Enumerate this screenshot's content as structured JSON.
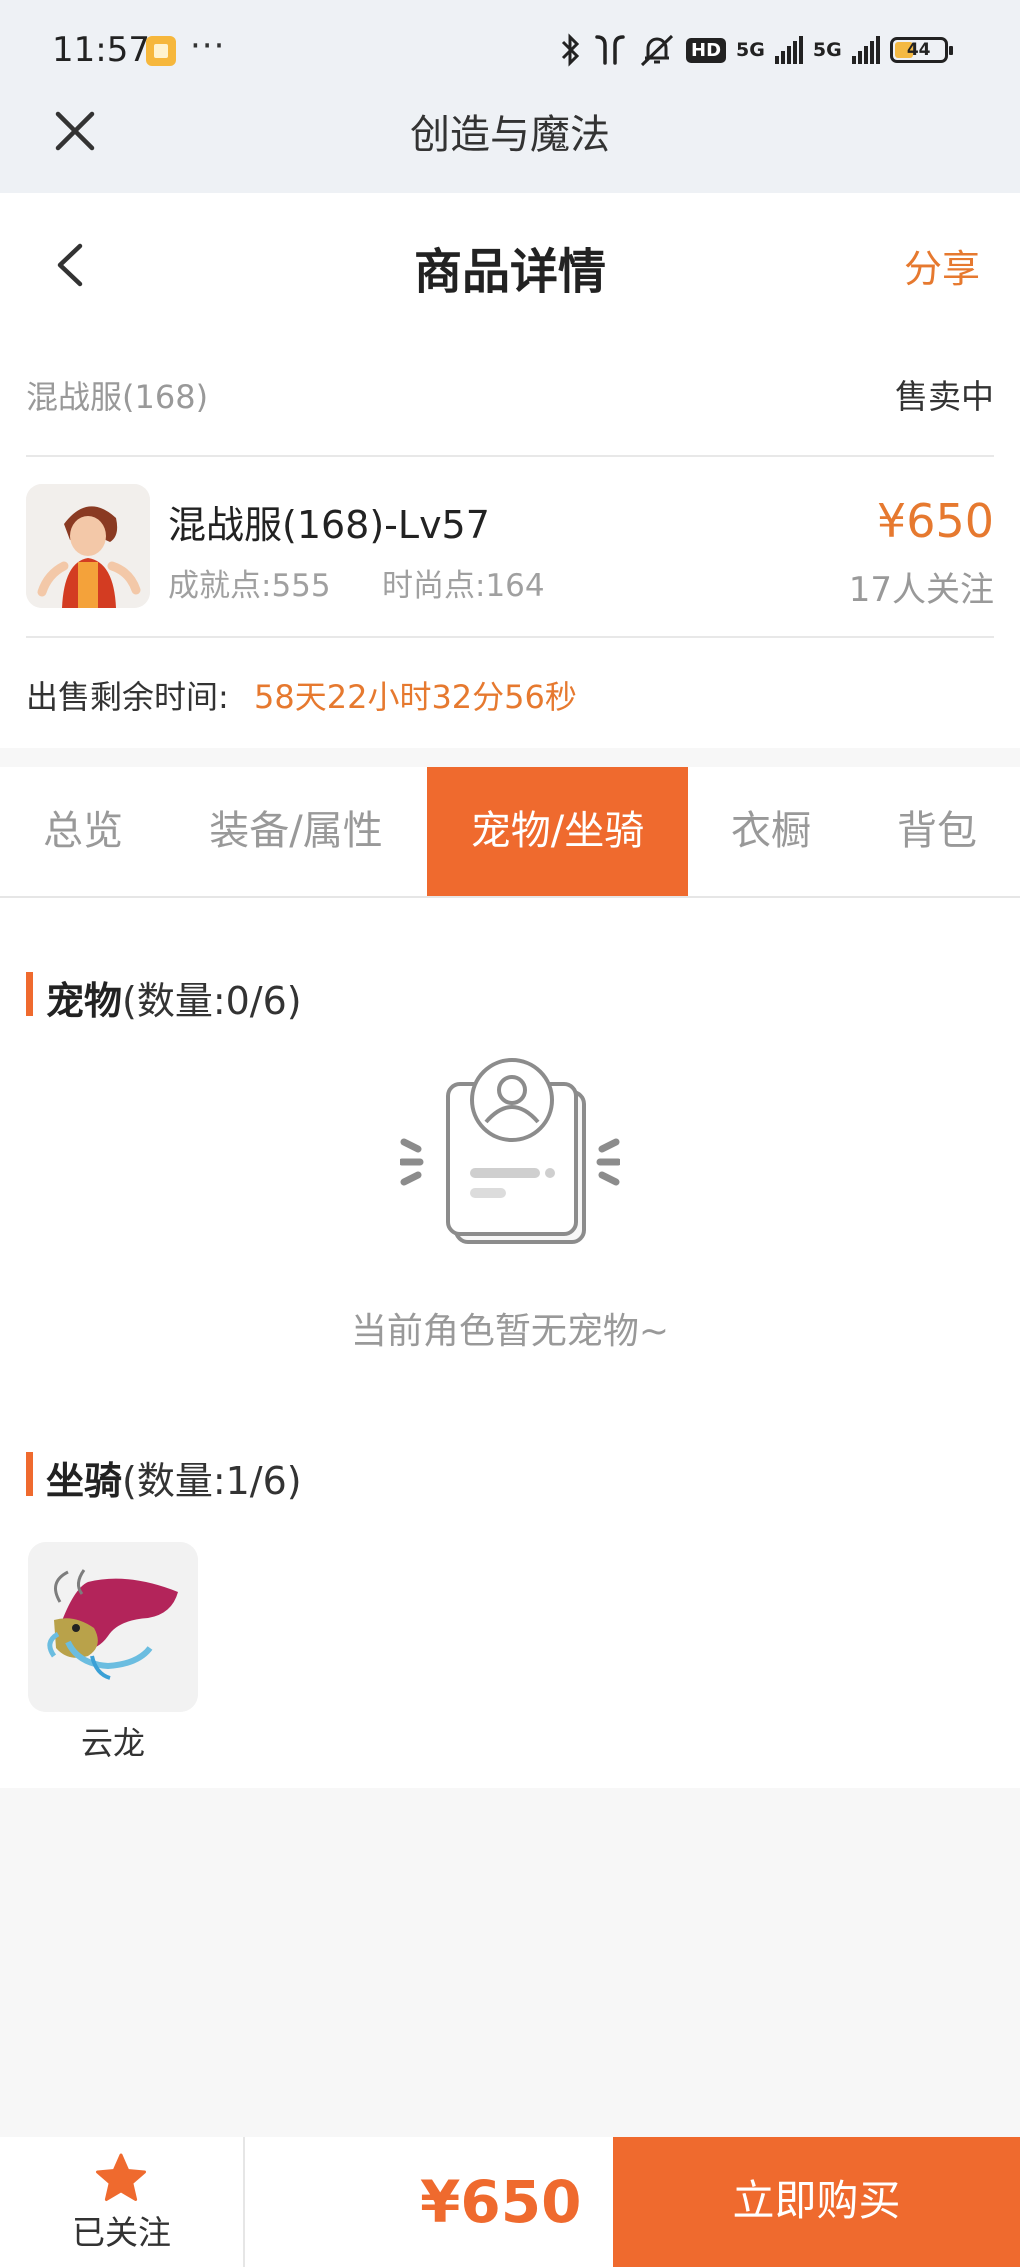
{
  "status_bar": {
    "time": "11:57",
    "dots": "···",
    "icons": [
      "bluetooth-icon",
      "earbuds-icon",
      "mute-icon",
      "hd-icon",
      "signal-5g-icon",
      "signal-5g-icon",
      "battery-icon"
    ],
    "hd_label": "HD",
    "net1": "5G",
    "net2": "5G",
    "battery_level": "44"
  },
  "miniapp": {
    "title": "创造与魔法"
  },
  "header": {
    "title": "商品详情",
    "share_label": "分享"
  },
  "listing": {
    "server": "混战服(168)",
    "status": "售卖中",
    "name": "混战服(168)-Lv57",
    "achievement": "成就点:555",
    "fashion": "时尚点:164",
    "price": "¥650",
    "followers": "17人关注",
    "time_label": "出售剩余时间:",
    "time_value": "58天22小时32分56秒"
  },
  "tabs": [
    {
      "label": "总览",
      "active": false
    },
    {
      "label": "装备/属性",
      "active": false
    },
    {
      "label": "宠物/坐骑",
      "active": true
    },
    {
      "label": "衣橱",
      "active": false
    },
    {
      "label": "背包",
      "active": false
    }
  ],
  "pets": {
    "title": "宠物",
    "count": "(数量:0/6)",
    "empty_text": "当前角色暂无宠物~"
  },
  "mounts": {
    "title": "坐骑",
    "count": "(数量:1/6)",
    "items": [
      {
        "name": "云龙"
      }
    ]
  },
  "bottom_bar": {
    "follow_label": "已关注",
    "price": "¥650",
    "buy_label": "立即购买"
  },
  "colors": {
    "accent": "#ef6a2e",
    "price": "#e6792f",
    "topbar_bg": "#eef1f5"
  }
}
